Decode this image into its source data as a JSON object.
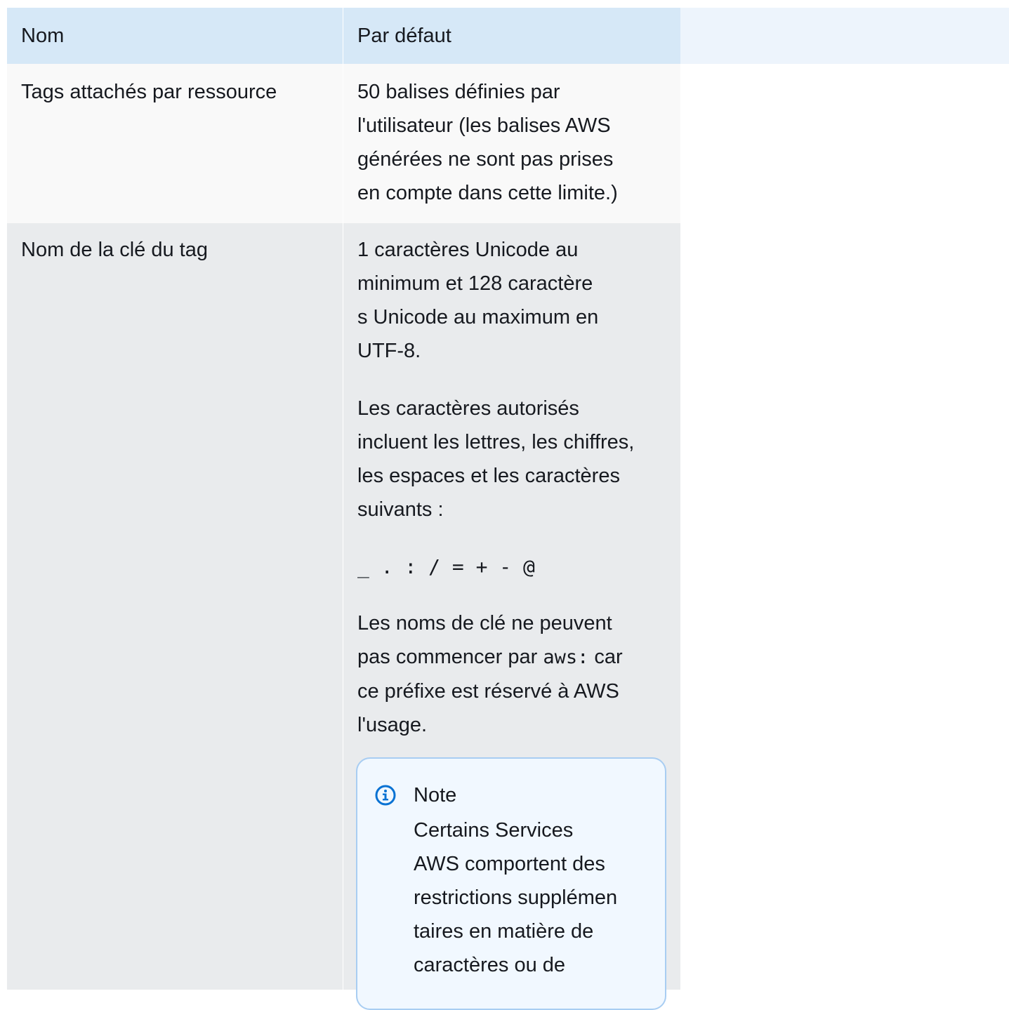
{
  "table": {
    "headers": {
      "name": "Nom",
      "default": "Par défaut"
    },
    "rows": [
      {
        "name": "Tags attachés par ressource",
        "default": "50 balises définies par\nl'utilisateur (les balises AWS\ngénérées ne sont pas prises\nen compte dans cette limite.)"
      },
      {
        "name": "Nom de la clé du tag",
        "default_p1": "1 caractères Unicode au\nminimum et 128 caractère\ns Unicode au maximum en\nUTF-8.",
        "default_p2": "Les caractères autorisés\nincluent les lettres, les chiffres,\nles espaces et les caractères\nsuivants :",
        "allowed_chars": "_ . : / = + - @",
        "default_p3_before": "Les noms de clé ne peuvent\npas commencer par ",
        "default_p3_code": "aws:",
        "default_p3_after": " car\nce préfixe est réservé à AWS\nl'usage.",
        "note": {
          "icon": "info-icon",
          "title": "Note",
          "body": "Certains Services\nAWS comportent des\nrestrictions supplémen\ntaires en matière de\ncaractères ou de"
        }
      }
    ]
  },
  "colors": {
    "header_bg": "#d6e8f7",
    "header_extra_bg": "#edf4fc",
    "row1_bg": "#f9f9f9",
    "row2_bg": "#e9ebed",
    "note_bg": "#f1f8ff",
    "note_border": "#a8cdf2",
    "info_icon": "#0972d3"
  }
}
